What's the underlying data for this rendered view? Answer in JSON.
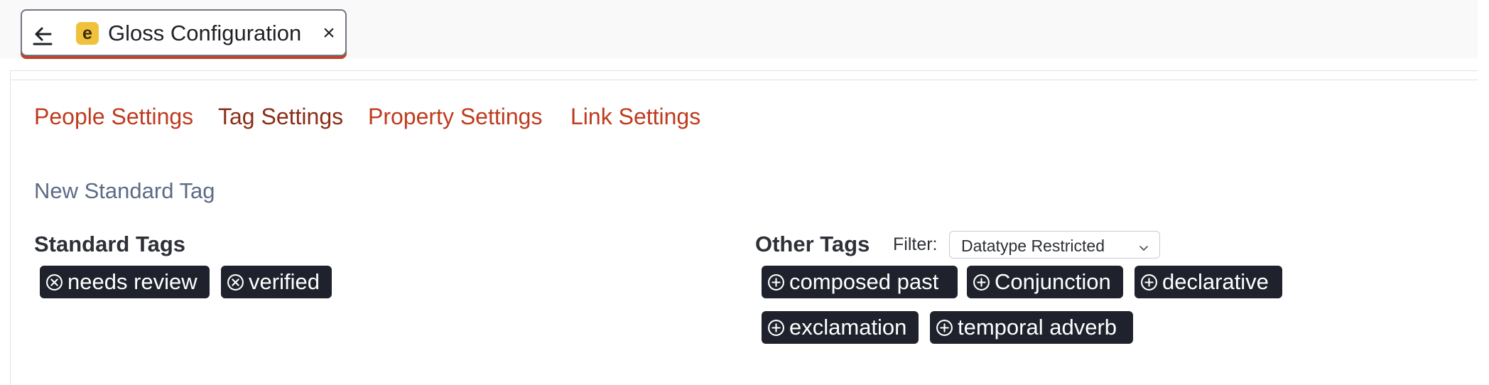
{
  "tab": {
    "title": "Gloss Configuration",
    "logo_letter": "e",
    "close_glyph": "×"
  },
  "nav": {
    "items": [
      {
        "label": "People Settings",
        "active": false
      },
      {
        "label": "Tag Settings",
        "active": true
      },
      {
        "label": "Property Settings",
        "active": false
      },
      {
        "label": "Link Settings",
        "active": false
      }
    ]
  },
  "new_tag_link": "New Standard Tag",
  "standard_tags": {
    "heading": "Standard Tags",
    "items": [
      "needs review",
      "verified"
    ],
    "chip_icon": "circle-x-icon"
  },
  "other_tags": {
    "heading": "Other Tags",
    "filter_label": "Filter:",
    "filter_value": "Datatype Restricted",
    "items": [
      "composed past",
      "Conjunction",
      "declarative",
      "exclamation",
      "temporal adverb"
    ],
    "chip_icon": "circle-plus-icon"
  },
  "colors": {
    "link": "#bf3b1e",
    "link_active": "#8a2d16",
    "chip_bg": "#1f222c",
    "tab_underline": "#c0422a",
    "logo": "#f0c23c"
  }
}
